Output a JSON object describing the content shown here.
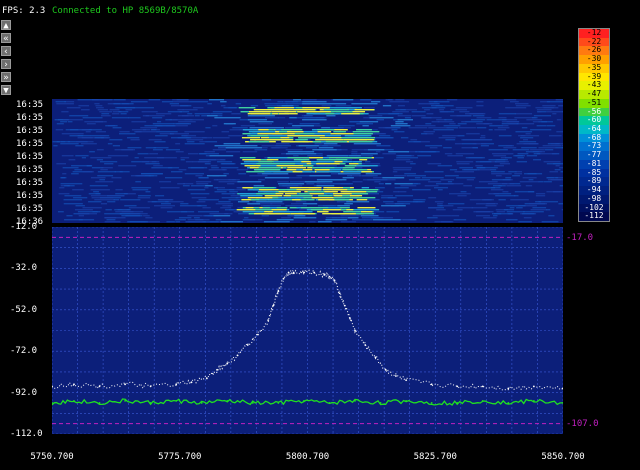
{
  "header": {
    "fps_text": "FPS: 2.3",
    "status_text": "Connected to HP 8569B/8570A"
  },
  "nav_buttons": [
    {
      "name": "scroll-up-button",
      "icon": "up-arrow-icon",
      "glyph": "▲"
    },
    {
      "name": "rewind-fast-button",
      "icon": "double-left-icon",
      "glyph": "«"
    },
    {
      "name": "rewind-button",
      "icon": "left-icon",
      "glyph": "‹"
    },
    {
      "name": "forward-button",
      "icon": "right-icon",
      "glyph": "›"
    },
    {
      "name": "forward-fast-button",
      "icon": "double-right-icon",
      "glyph": "»"
    },
    {
      "name": "scroll-down-button",
      "icon": "down-arrow-icon",
      "glyph": "▼"
    }
  ],
  "waterfall": {
    "timestamps": [
      "16:35",
      "16:35",
      "16:35",
      "16:35",
      "16:35",
      "16:35",
      "16:35",
      "16:35",
      "16:35",
      "16:36"
    ]
  },
  "legend": {
    "values": [
      "-12",
      "-22",
      "-26",
      "-30",
      "-35",
      "-39",
      "-43",
      "-47",
      "-51",
      "-56",
      "-60",
      "-64",
      "-68",
      "-73",
      "-77",
      "-81",
      "-85",
      "-89",
      "-94",
      "-98",
      "-102",
      "-112"
    ],
    "colors": [
      "#ff2020",
      "#ff4a1a",
      "#ff7a10",
      "#ffa000",
      "#ffc800",
      "#ffe600",
      "#e8f000",
      "#b8ea00",
      "#80e000",
      "#40d040",
      "#00c89a",
      "#00b8c8",
      "#0090d8",
      "#0070d0",
      "#0058c0",
      "#0040b0",
      "#0030a0",
      "#002890",
      "#002080",
      "#001870",
      "#001060",
      "#000850"
    ]
  },
  "reference_lines": {
    "top_label": "-17.0",
    "bottom_label": "-107.0",
    "color": "#c020c0"
  },
  "chart_data": {
    "type": "line",
    "xlabel": "",
    "ylabel": "",
    "xlim": [
      5750.7,
      5850.7
    ],
    "ylim": [
      -112.0,
      -12.0
    ],
    "x_ticks": [
      "5750.700",
      "5775.700",
      "5800.700",
      "5825.700",
      "5850.700"
    ],
    "y_ticks": [
      "-12.0",
      "-32.0",
      "-52.0",
      "-72.0",
      "-92.0",
      "-112.0"
    ],
    "grid": true,
    "series": [
      {
        "style": "dotted-white",
        "x": [
          5750.7,
          5755,
          5760,
          5765,
          5770,
          5775,
          5778,
          5781,
          5783,
          5785,
          5787,
          5789,
          5791,
          5793,
          5794,
          5795,
          5796,
          5797,
          5798,
          5800,
          5802,
          5804,
          5805,
          5806,
          5807,
          5808,
          5809,
          5810,
          5812,
          5814,
          5816,
          5818,
          5820,
          5825,
          5830,
          5835,
          5840,
          5845,
          5850.7
        ],
        "y": [
          -89,
          -88,
          -89,
          -88,
          -89,
          -88,
          -87,
          -85,
          -81,
          -78,
          -74,
          -69,
          -64,
          -57,
          -50,
          -43,
          -37,
          -34,
          -34,
          -34,
          -34,
          -35,
          -36,
          -38,
          -44,
          -50,
          -56,
          -62,
          -69,
          -75,
          -81,
          -84,
          -86,
          -88,
          -89,
          -89,
          -90,
          -89,
          -90
        ]
      },
      {
        "style": "solid-green",
        "x": [
          5750.7,
          5755,
          5760,
          5765,
          5770,
          5775,
          5780,
          5785,
          5790,
          5795,
          5800,
          5805,
          5810,
          5815,
          5820,
          5825,
          5830,
          5835,
          5840,
          5845,
          5850.7
        ],
        "y": [
          -97,
          -96,
          -97,
          -96,
          -97,
          -96,
          -97,
          -96,
          -97,
          -97,
          -96,
          -97,
          -96,
          -97,
          -96,
          -97,
          -97,
          -96,
          -97,
          -96,
          -97
        ]
      }
    ],
    "reference_levels": [
      -17.0,
      -107.0
    ]
  }
}
